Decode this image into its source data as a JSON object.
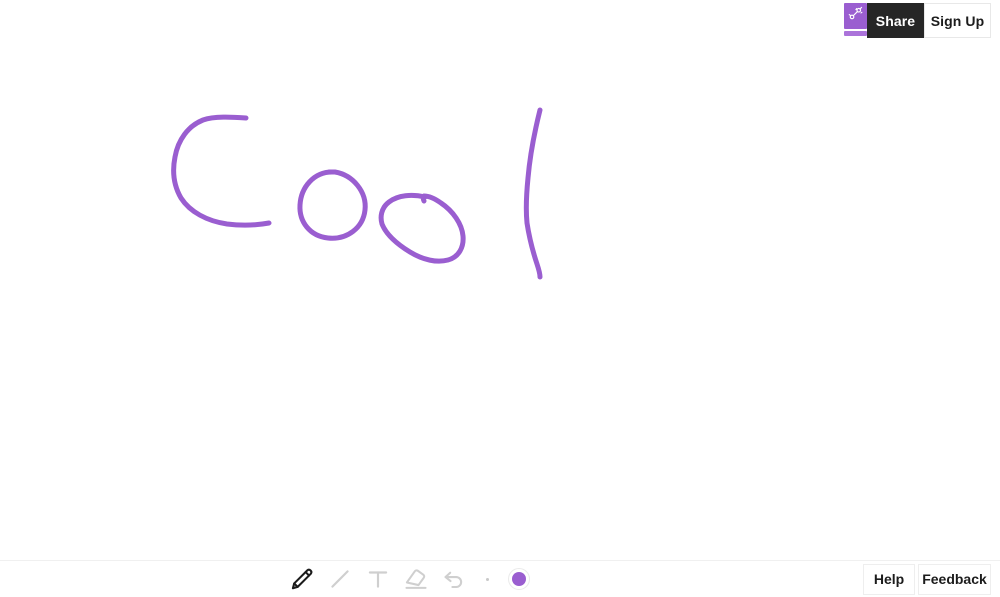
{
  "app": {
    "name": "whiteboard-app",
    "background_color": "#ffffff"
  },
  "header": {
    "logo": {
      "icon": "magic-wand-icon",
      "tile_color": "#9a5ed0",
      "accent_color": "#ab73da"
    },
    "share_label": "Share",
    "signup_label": "Sign Up",
    "share_bg": "#262626",
    "share_text_color": "#ffffff",
    "signup_bg": "#ffffff",
    "signup_text_color": "#1c1c1c"
  },
  "canvas": {
    "stroke_color": "#9a5ed0",
    "stroke_width": 5,
    "drawn_text": "Cool",
    "strokes": [
      {
        "name": "letter-c",
        "icon": "freehand-stroke"
      },
      {
        "name": "letter-o-1",
        "icon": "freehand-stroke"
      },
      {
        "name": "letter-o-2",
        "icon": "freehand-stroke"
      },
      {
        "name": "letter-l",
        "icon": "freehand-stroke"
      }
    ]
  },
  "toolbar": {
    "tools": [
      {
        "name": "pencil-tool",
        "icon": "pencil-icon",
        "label": "Pencil",
        "active": true
      },
      {
        "name": "line-tool",
        "icon": "line-icon",
        "label": "Line",
        "active": false
      },
      {
        "name": "text-tool",
        "icon": "text-icon",
        "label": "Text",
        "active": false
      },
      {
        "name": "eraser-tool",
        "icon": "eraser-icon",
        "label": "Eraser",
        "active": false
      },
      {
        "name": "undo-tool",
        "icon": "undo-icon",
        "label": "Undo",
        "active": false
      }
    ],
    "stroke_width_label": "Stroke width",
    "color_label": "Color",
    "selected_color": "#9a5ed0",
    "active_icon_color": "#1c1c1c",
    "inactive_icon_color": "#cfcfcf"
  },
  "footer": {
    "help_label": "Help",
    "feedback_label": "Feedback"
  }
}
